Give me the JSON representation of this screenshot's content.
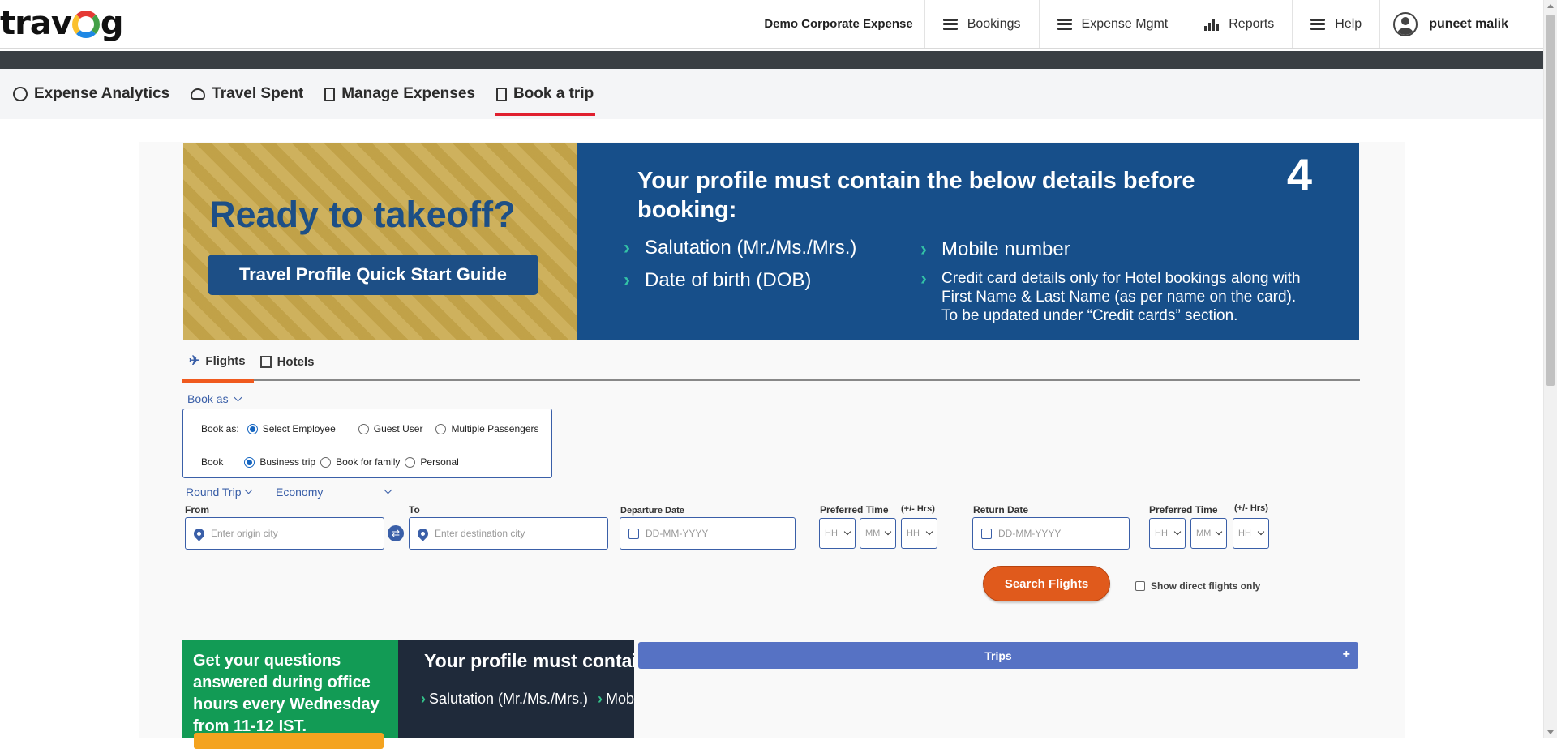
{
  "header": {
    "logo_left": "trav",
    "logo_right": "g",
    "company": "Demo Corporate Expense",
    "nav": [
      {
        "label": "Bookings",
        "icon": "menu-icon"
      },
      {
        "label": "Expense Mgmt",
        "icon": "menu-icon"
      },
      {
        "label": "Reports",
        "icon": "bar-chart-icon"
      },
      {
        "label": "Help",
        "icon": "menu-icon"
      }
    ],
    "user": "puneet malik"
  },
  "subtabs": [
    {
      "label": "Expense Analytics",
      "active": false
    },
    {
      "label": "Travel Spent",
      "active": false
    },
    {
      "label": "Manage Expenses",
      "active": false
    },
    {
      "label": "Book a trip",
      "active": true
    }
  ],
  "banner": {
    "title": "Ready to takeoff?",
    "button": "Travel Profile Quick Start Guide",
    "number": "4",
    "heading": "Your profile must contain the below details before booking:",
    "items": [
      "Salutation (Mr./Ms./Mrs.)",
      "Date of birth (DOB)",
      "Mobile number",
      "Credit card details only for Hotel bookings along with First Name & Last Name (as per name on the card). To be updated under “Credit cards” section."
    ]
  },
  "booking_tabs": [
    {
      "label": "Flights",
      "active": true
    },
    {
      "label": "Hotels",
      "active": false
    }
  ],
  "book_as": {
    "link": "Book as",
    "row1_label": "Book as:",
    "row1_options": [
      "Select Employee",
      "Guest User",
      "Multiple Passengers"
    ],
    "row1_selected": "Select Employee",
    "row2_label": "Book",
    "row2_options": [
      "Business trip",
      "Book for family",
      "Personal"
    ],
    "row2_selected": "Business trip"
  },
  "search": {
    "trip_type": "Round Trip",
    "cabin_class": "Economy",
    "from_label": "From",
    "from_placeholder": "Enter origin city",
    "to_label": "To",
    "to_placeholder": "Enter destination city",
    "departure_label": "Departure Date",
    "departure_placeholder": "DD-MM-YYYY",
    "return_label": "Return Date",
    "return_placeholder": "DD-MM-YYYY",
    "preferred_time_label": "Preferred Time",
    "tolerance_label": "(+/- Hrs)",
    "hh": "HH",
    "mm": "MM",
    "search_button": "Search Flights",
    "direct_only": "Show direct flights only"
  },
  "promo": {
    "green_text": "Get your questions answered during office hours every Wednesday from 11-12 IST.",
    "dark_heading": "Your profile must contain the b",
    "dark_item1": "Salutation (Mr./Ms./Mrs.)",
    "dark_item2": "Mobi"
  },
  "trips": {
    "label": "Trips",
    "toggle": "+"
  }
}
